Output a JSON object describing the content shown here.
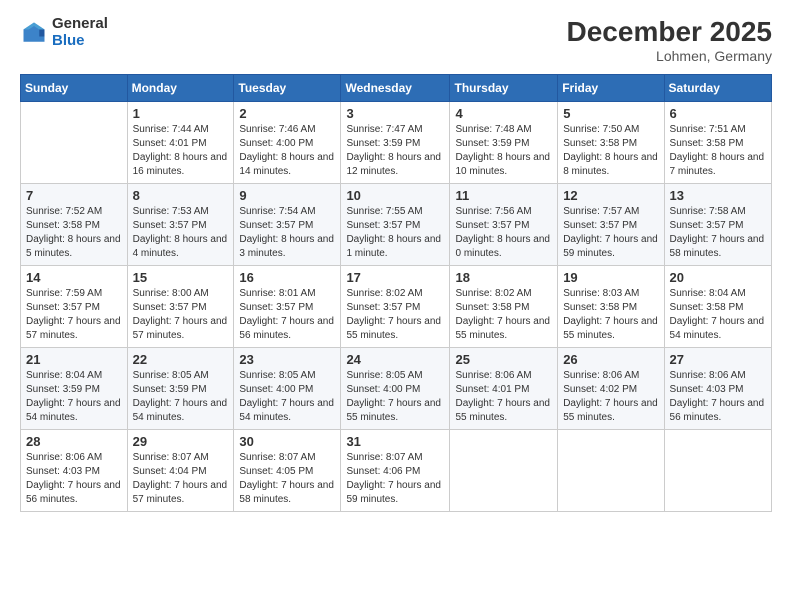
{
  "header": {
    "logo_general": "General",
    "logo_blue": "Blue",
    "month_title": "December 2025",
    "location": "Lohmen, Germany"
  },
  "weekdays": [
    "Sunday",
    "Monday",
    "Tuesday",
    "Wednesday",
    "Thursday",
    "Friday",
    "Saturday"
  ],
  "weeks": [
    [
      {
        "day": "",
        "sunrise": "",
        "sunset": "",
        "daylight": ""
      },
      {
        "day": "1",
        "sunrise": "Sunrise: 7:44 AM",
        "sunset": "Sunset: 4:01 PM",
        "daylight": "Daylight: 8 hours and 16 minutes."
      },
      {
        "day": "2",
        "sunrise": "Sunrise: 7:46 AM",
        "sunset": "Sunset: 4:00 PM",
        "daylight": "Daylight: 8 hours and 14 minutes."
      },
      {
        "day": "3",
        "sunrise": "Sunrise: 7:47 AM",
        "sunset": "Sunset: 3:59 PM",
        "daylight": "Daylight: 8 hours and 12 minutes."
      },
      {
        "day": "4",
        "sunrise": "Sunrise: 7:48 AM",
        "sunset": "Sunset: 3:59 PM",
        "daylight": "Daylight: 8 hours and 10 minutes."
      },
      {
        "day": "5",
        "sunrise": "Sunrise: 7:50 AM",
        "sunset": "Sunset: 3:58 PM",
        "daylight": "Daylight: 8 hours and 8 minutes."
      },
      {
        "day": "6",
        "sunrise": "Sunrise: 7:51 AM",
        "sunset": "Sunset: 3:58 PM",
        "daylight": "Daylight: 8 hours and 7 minutes."
      }
    ],
    [
      {
        "day": "7",
        "sunrise": "Sunrise: 7:52 AM",
        "sunset": "Sunset: 3:58 PM",
        "daylight": "Daylight: 8 hours and 5 minutes."
      },
      {
        "day": "8",
        "sunrise": "Sunrise: 7:53 AM",
        "sunset": "Sunset: 3:57 PM",
        "daylight": "Daylight: 8 hours and 4 minutes."
      },
      {
        "day": "9",
        "sunrise": "Sunrise: 7:54 AM",
        "sunset": "Sunset: 3:57 PM",
        "daylight": "Daylight: 8 hours and 3 minutes."
      },
      {
        "day": "10",
        "sunrise": "Sunrise: 7:55 AM",
        "sunset": "Sunset: 3:57 PM",
        "daylight": "Daylight: 8 hours and 1 minute."
      },
      {
        "day": "11",
        "sunrise": "Sunrise: 7:56 AM",
        "sunset": "Sunset: 3:57 PM",
        "daylight": "Daylight: 8 hours and 0 minutes."
      },
      {
        "day": "12",
        "sunrise": "Sunrise: 7:57 AM",
        "sunset": "Sunset: 3:57 PM",
        "daylight": "Daylight: 7 hours and 59 minutes."
      },
      {
        "day": "13",
        "sunrise": "Sunrise: 7:58 AM",
        "sunset": "Sunset: 3:57 PM",
        "daylight": "Daylight: 7 hours and 58 minutes."
      }
    ],
    [
      {
        "day": "14",
        "sunrise": "Sunrise: 7:59 AM",
        "sunset": "Sunset: 3:57 PM",
        "daylight": "Daylight: 7 hours and 57 minutes."
      },
      {
        "day": "15",
        "sunrise": "Sunrise: 8:00 AM",
        "sunset": "Sunset: 3:57 PM",
        "daylight": "Daylight: 7 hours and 57 minutes."
      },
      {
        "day": "16",
        "sunrise": "Sunrise: 8:01 AM",
        "sunset": "Sunset: 3:57 PM",
        "daylight": "Daylight: 7 hours and 56 minutes."
      },
      {
        "day": "17",
        "sunrise": "Sunrise: 8:02 AM",
        "sunset": "Sunset: 3:57 PM",
        "daylight": "Daylight: 7 hours and 55 minutes."
      },
      {
        "day": "18",
        "sunrise": "Sunrise: 8:02 AM",
        "sunset": "Sunset: 3:58 PM",
        "daylight": "Daylight: 7 hours and 55 minutes."
      },
      {
        "day": "19",
        "sunrise": "Sunrise: 8:03 AM",
        "sunset": "Sunset: 3:58 PM",
        "daylight": "Daylight: 7 hours and 55 minutes."
      },
      {
        "day": "20",
        "sunrise": "Sunrise: 8:04 AM",
        "sunset": "Sunset: 3:58 PM",
        "daylight": "Daylight: 7 hours and 54 minutes."
      }
    ],
    [
      {
        "day": "21",
        "sunrise": "Sunrise: 8:04 AM",
        "sunset": "Sunset: 3:59 PM",
        "daylight": "Daylight: 7 hours and 54 minutes."
      },
      {
        "day": "22",
        "sunrise": "Sunrise: 8:05 AM",
        "sunset": "Sunset: 3:59 PM",
        "daylight": "Daylight: 7 hours and 54 minutes."
      },
      {
        "day": "23",
        "sunrise": "Sunrise: 8:05 AM",
        "sunset": "Sunset: 4:00 PM",
        "daylight": "Daylight: 7 hours and 54 minutes."
      },
      {
        "day": "24",
        "sunrise": "Sunrise: 8:05 AM",
        "sunset": "Sunset: 4:00 PM",
        "daylight": "Daylight: 7 hours and 55 minutes."
      },
      {
        "day": "25",
        "sunrise": "Sunrise: 8:06 AM",
        "sunset": "Sunset: 4:01 PM",
        "daylight": "Daylight: 7 hours and 55 minutes."
      },
      {
        "day": "26",
        "sunrise": "Sunrise: 8:06 AM",
        "sunset": "Sunset: 4:02 PM",
        "daylight": "Daylight: 7 hours and 55 minutes."
      },
      {
        "day": "27",
        "sunrise": "Sunrise: 8:06 AM",
        "sunset": "Sunset: 4:03 PM",
        "daylight": "Daylight: 7 hours and 56 minutes."
      }
    ],
    [
      {
        "day": "28",
        "sunrise": "Sunrise: 8:06 AM",
        "sunset": "Sunset: 4:03 PM",
        "daylight": "Daylight: 7 hours and 56 minutes."
      },
      {
        "day": "29",
        "sunrise": "Sunrise: 8:07 AM",
        "sunset": "Sunset: 4:04 PM",
        "daylight": "Daylight: 7 hours and 57 minutes."
      },
      {
        "day": "30",
        "sunrise": "Sunrise: 8:07 AM",
        "sunset": "Sunset: 4:05 PM",
        "daylight": "Daylight: 7 hours and 58 minutes."
      },
      {
        "day": "31",
        "sunrise": "Sunrise: 8:07 AM",
        "sunset": "Sunset: 4:06 PM",
        "daylight": "Daylight: 7 hours and 59 minutes."
      },
      {
        "day": "",
        "sunrise": "",
        "sunset": "",
        "daylight": ""
      },
      {
        "day": "",
        "sunrise": "",
        "sunset": "",
        "daylight": ""
      },
      {
        "day": "",
        "sunrise": "",
        "sunset": "",
        "daylight": ""
      }
    ]
  ]
}
